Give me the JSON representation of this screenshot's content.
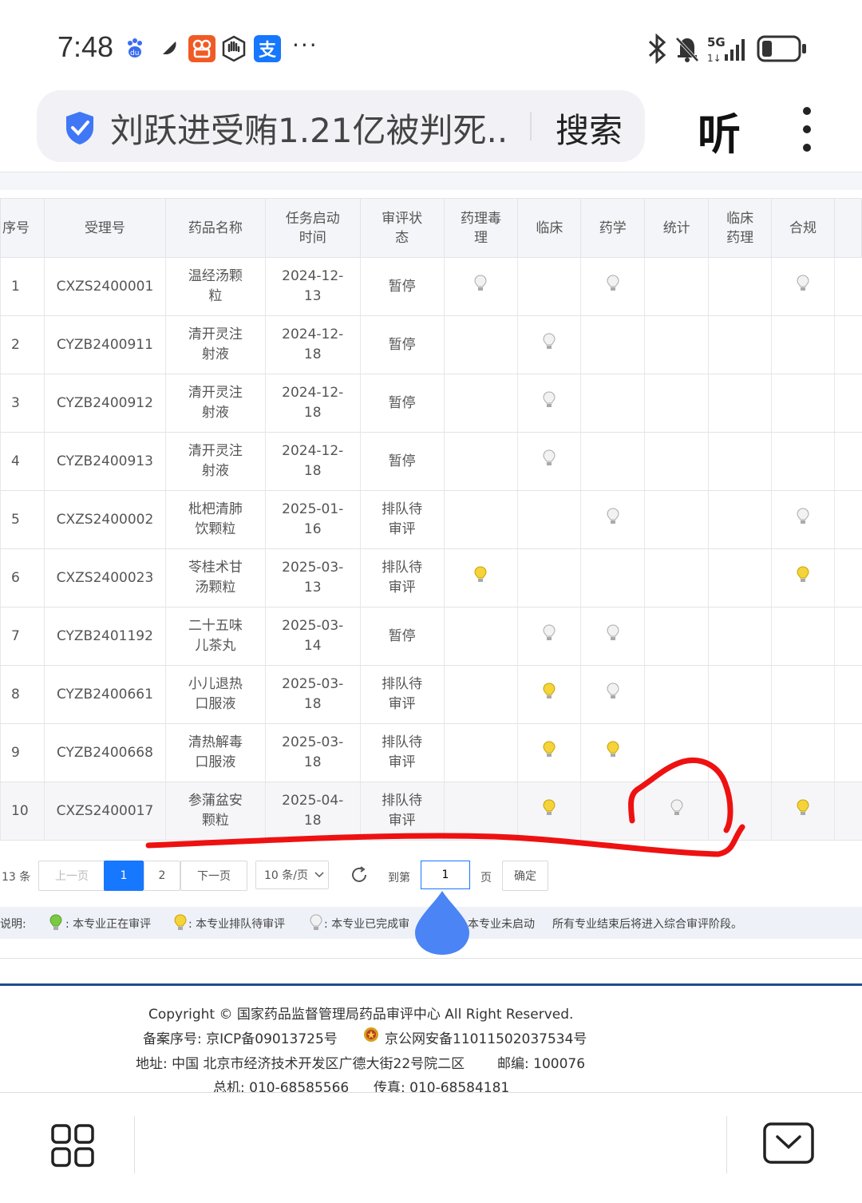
{
  "status_bar": {
    "time": "7:48",
    "icons_left": [
      "baidu-paw-icon",
      "feather-icon",
      "kuaishou-icon",
      "hand-icon",
      "alipay-icon"
    ],
    "alipay_char": "支",
    "more": "···",
    "network": "5G",
    "icons_right": [
      "bluetooth-icon",
      "mute-bell-icon",
      "signal-icon",
      "battery-icon"
    ]
  },
  "search": {
    "query": "刘跃进受贿1.21亿被判死...",
    "button": "搜索"
  },
  "listen_button": "听",
  "table": {
    "headers": [
      "序号",
      "受理号",
      "药品名称",
      "任务启动时间",
      "审评状态",
      "药理毒理",
      "临床",
      "药学",
      "统计",
      "临床药理",
      "合规"
    ],
    "header_display": {
      "start_time": [
        "任务启动",
        "时间"
      ],
      "status": [
        "审评状",
        "态"
      ],
      "pharm": [
        "药理毒",
        "理"
      ],
      "clin_pharm": [
        "临床",
        "药理"
      ]
    },
    "rows": [
      {
        "num": "1",
        "acc": "CXZS2400001",
        "name": [
          "温经汤颗",
          "粒"
        ],
        "date": [
          "2024-12-",
          "13"
        ],
        "status": [
          "暂停"
        ],
        "bulbs": [
          "done",
          "",
          "done",
          "",
          "",
          "done"
        ]
      },
      {
        "num": "2",
        "acc": "CYZB2400911",
        "name": [
          "清开灵注",
          "射液"
        ],
        "date": [
          "2024-12-",
          "18"
        ],
        "status": [
          "暂停"
        ],
        "bulbs": [
          "",
          "done",
          "",
          "",
          "",
          ""
        ]
      },
      {
        "num": "3",
        "acc": "CYZB2400912",
        "name": [
          "清开灵注",
          "射液"
        ],
        "date": [
          "2024-12-",
          "18"
        ],
        "status": [
          "暂停"
        ],
        "bulbs": [
          "",
          "done",
          "",
          "",
          "",
          ""
        ]
      },
      {
        "num": "4",
        "acc": "CYZB2400913",
        "name": [
          "清开灵注",
          "射液"
        ],
        "date": [
          "2024-12-",
          "18"
        ],
        "status": [
          "暂停"
        ],
        "bulbs": [
          "",
          "done",
          "",
          "",
          "",
          ""
        ]
      },
      {
        "num": "5",
        "acc": "CXZS2400002",
        "name": [
          "枇杷清肺",
          "饮颗粒"
        ],
        "date": [
          "2025-01-",
          "16"
        ],
        "status": [
          "排队待",
          "审评"
        ],
        "bulbs": [
          "",
          "",
          "done",
          "",
          "",
          "done"
        ]
      },
      {
        "num": "6",
        "acc": "CXZS2400023",
        "name": [
          "苓桂术甘",
          "汤颗粒"
        ],
        "date": [
          "2025-03-",
          "13"
        ],
        "status": [
          "排队待",
          "审评"
        ],
        "bulbs": [
          "queue",
          "",
          "",
          "",
          "",
          "queue"
        ]
      },
      {
        "num": "7",
        "acc": "CYZB2401192",
        "name": [
          "二十五味",
          "儿茶丸"
        ],
        "date": [
          "2025-03-",
          "14"
        ],
        "status": [
          "暂停"
        ],
        "bulbs": [
          "",
          "done",
          "done",
          "",
          "",
          ""
        ]
      },
      {
        "num": "8",
        "acc": "CYZB2400661",
        "name": [
          "小儿退热",
          "口服液"
        ],
        "date": [
          "2025-03-",
          "18"
        ],
        "status": [
          "排队待",
          "审评"
        ],
        "bulbs": [
          "",
          "queue",
          "done",
          "",
          "",
          ""
        ]
      },
      {
        "num": "9",
        "acc": "CYZB2400668",
        "name": [
          "清热解毒",
          "口服液"
        ],
        "date": [
          "2025-03-",
          "18"
        ],
        "status": [
          "排队待",
          "审评"
        ],
        "bulbs": [
          "",
          "queue",
          "queue",
          "",
          "",
          ""
        ]
      },
      {
        "num": "10",
        "acc": "CXZS2400017",
        "name": [
          "参蒲盆安",
          "颗粒"
        ],
        "date": [
          "2025-04-",
          "18"
        ],
        "status": [
          "排队待",
          "审评"
        ],
        "bulbs": [
          "",
          "queue",
          "",
          "done",
          "",
          "queue"
        ]
      }
    ]
  },
  "pagination": {
    "total": "13 条",
    "prev": "上一页",
    "pages": [
      "1",
      "2"
    ],
    "active_page": "1",
    "next": "下一页",
    "page_size": "10 条/页",
    "goto_label": "到第",
    "goto_value": "1",
    "page_suffix": "页",
    "confirm": "确定"
  },
  "legend": {
    "label": "说明:",
    "reviewing": ": 本专业正在审评",
    "queue": ": 本专业排队待审评",
    "done": ": 本专业已完成审",
    "not_started": "本专业未启动",
    "note": "所有专业结束后将进入综合审评阶段。"
  },
  "footer": {
    "copyright": "Copyright © 国家药品监督管理局药品审评中心   All Right Reserved.",
    "icp": "备案序号: 京ICP备09013725号",
    "police": "京公网安备11011502037534号",
    "address": "地址: 中国 北京市经济技术开发区广德大街22号院二区",
    "postcode": "邮编: 100076",
    "phone": "总机: 010-68585566",
    "fax": "传真: 010-68584181"
  },
  "colors": {
    "accent": "#1677ff",
    "bulb_done": "#e6e6e6",
    "bulb_queue": "#f5d33a",
    "bulb_reviewing": "#7ac943",
    "annotation": "#ee1111",
    "footer_rule": "#1f4d8c"
  }
}
